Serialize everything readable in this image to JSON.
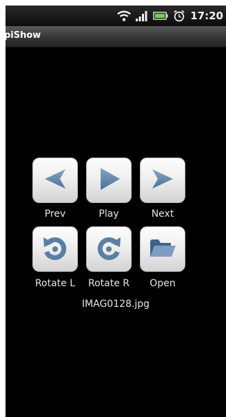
{
  "status_bar": {
    "time": "17:20",
    "icons": [
      "wifi-icon",
      "signal-icon",
      "battery-icon",
      "alarm-icon"
    ]
  },
  "app": {
    "title": "piShow"
  },
  "controls": {
    "prev": {
      "label": "Prev",
      "icon": "arrow-left-icon"
    },
    "play": {
      "label": "Play",
      "icon": "play-icon"
    },
    "next": {
      "label": "Next",
      "icon": "arrow-right-icon"
    },
    "rotate_left": {
      "label": "Rotate L",
      "icon": "rotate-left-icon"
    },
    "rotate_right": {
      "label": "Rotate R",
      "icon": "rotate-right-icon"
    },
    "open": {
      "label": "Open",
      "icon": "folder-open-icon"
    }
  },
  "current_file": "IMAG0128.jpg",
  "colors": {
    "background": "#000000",
    "icon_blue": "#5b7fa3",
    "button_face": "#efefef"
  }
}
